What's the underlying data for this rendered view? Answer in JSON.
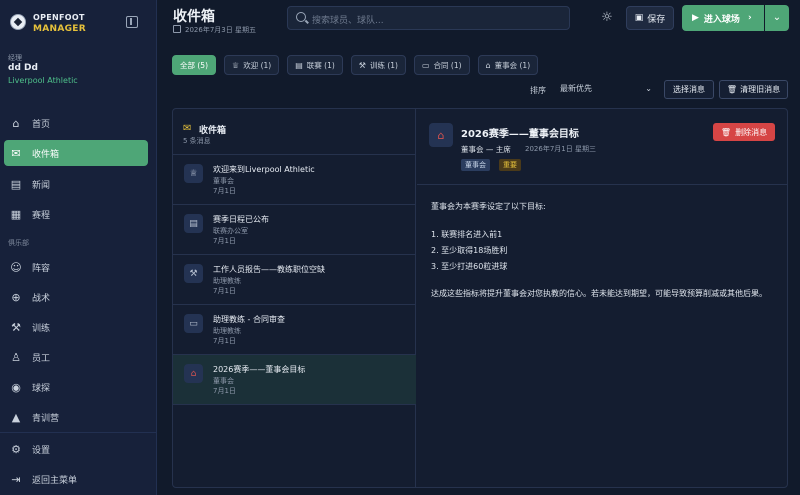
{
  "app": {
    "logo_line1": "OPENFOOT",
    "logo_line2": "MANAGER"
  },
  "manager": {
    "role": "经理",
    "name": "dd Dd",
    "club": "Liverpool Athletic"
  },
  "sidebar": {
    "items": [
      {
        "label": "首页",
        "icon": "home-icon"
      },
      {
        "label": "收件箱",
        "icon": "mail-icon"
      },
      {
        "label": "新闻",
        "icon": "newspaper-icon"
      },
      {
        "label": "赛程",
        "icon": "calendar-icon"
      }
    ],
    "section_label": "俱乐部",
    "club_items": [
      {
        "label": "阵容",
        "icon": "users-icon"
      },
      {
        "label": "战术",
        "icon": "crosshair-icon"
      },
      {
        "label": "训练",
        "icon": "dumbbell-icon"
      },
      {
        "label": "员工",
        "icon": "staff-icon"
      },
      {
        "label": "球探",
        "icon": "eye-icon"
      },
      {
        "label": "青训营",
        "icon": "graduation-icon"
      }
    ],
    "bottom_items": [
      {
        "label": "设置",
        "icon": "gear-icon"
      },
      {
        "label": "返回主菜单",
        "icon": "logout-icon"
      }
    ]
  },
  "header": {
    "title": "收件箱",
    "date": "2026年7月3日 星期五",
    "search_placeholder": "搜索球员、球队...",
    "save_label": "保存",
    "enter_label": "进入球场"
  },
  "filters": [
    {
      "label": "全部 (5)",
      "icon": "",
      "active": true
    },
    {
      "label": "欢迎 (1)",
      "icon": "trophy-icon",
      "active": false
    },
    {
      "label": "联赛 (1)",
      "icon": "clipboard-icon",
      "active": false
    },
    {
      "label": "训练 (1)",
      "icon": "dumbbell-icon",
      "active": false
    },
    {
      "label": "合同 (1)",
      "icon": "document-icon",
      "active": false
    },
    {
      "label": "董事会 (1)",
      "icon": "bank-icon",
      "active": false
    }
  ],
  "sort": {
    "label": "排序",
    "selected": "最新优先",
    "select_messages_label": "选择消息",
    "clear_label": "清理旧消息"
  },
  "inbox": {
    "title": "收件箱",
    "count_text": "5 条消息",
    "messages": [
      {
        "title": "欢迎来到Liverpool Athletic",
        "sender": "董事会",
        "date": "7月1日",
        "icon": "trophy-icon"
      },
      {
        "title": "赛季日程已公布",
        "sender": "联赛办公室",
        "date": "7月1日",
        "icon": "clipboard-icon"
      },
      {
        "title": "工作人员报告——教练职位空缺",
        "sender": "助理教练",
        "date": "7月1日",
        "icon": "dumbbell-icon"
      },
      {
        "title": "助理教练 - 合同审查",
        "sender": "助理教练",
        "date": "7月1日",
        "icon": "document-icon"
      },
      {
        "title": "2026赛季——董事会目标",
        "sender": "董事会",
        "date": "7月1日",
        "icon": "bank-icon"
      }
    ]
  },
  "detail": {
    "title": "2026赛季——董事会目标",
    "from": "董事会 — 主席",
    "date": "2026年7月1日 星期三",
    "tags": [
      "董事会",
      "重要"
    ],
    "delete_label": "删除消息",
    "intro": "董事会为本赛季设定了以下目标:",
    "goals": [
      "1. 联赛排名进入前1",
      "2. 至少取得18场胜利",
      "3. 至少打进60粒进球"
    ],
    "closing": "达成这些指标将提升董事会对您执教的信心。若未能达到期望，可能导致预算削减或其他后果。"
  },
  "colors": {
    "accent": "#4ea677",
    "gold": "#e6c13b",
    "danger": "#d64545",
    "background": "#111a2b",
    "sidebar": "#17213a"
  }
}
